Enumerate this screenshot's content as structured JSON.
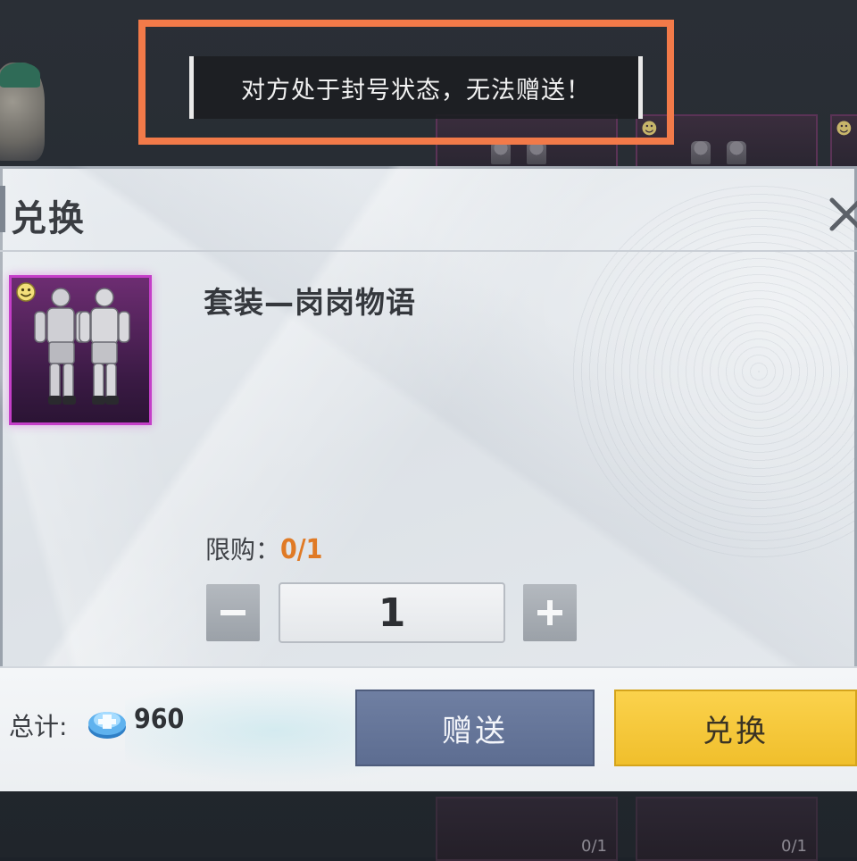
{
  "toast": {
    "message": "对方处于封号状态，无法赠送！"
  },
  "dialog": {
    "title": "兑换",
    "item": {
      "name": "套装—岗岗物语",
      "rarity_color": "#c43ec8"
    },
    "purchase_limit": {
      "label": "限购：",
      "value": "0/1"
    },
    "quantity": {
      "value": "1",
      "decrement_icon": "minus-icon",
      "increment_icon": "plus-icon"
    },
    "footer": {
      "total_label": "总计:",
      "currency_icon": "coin-icon",
      "total_amount": "960",
      "gift_label": "赠送",
      "redeem_label": "兑换"
    }
  },
  "background": {
    "bottom_counts": [
      "0/1",
      "0/1"
    ]
  },
  "colors": {
    "toast_highlight": "#f27a49",
    "limit_value": "#e07a25",
    "gift_button": "#6f7fa2",
    "redeem_button": "#fbd24c"
  }
}
